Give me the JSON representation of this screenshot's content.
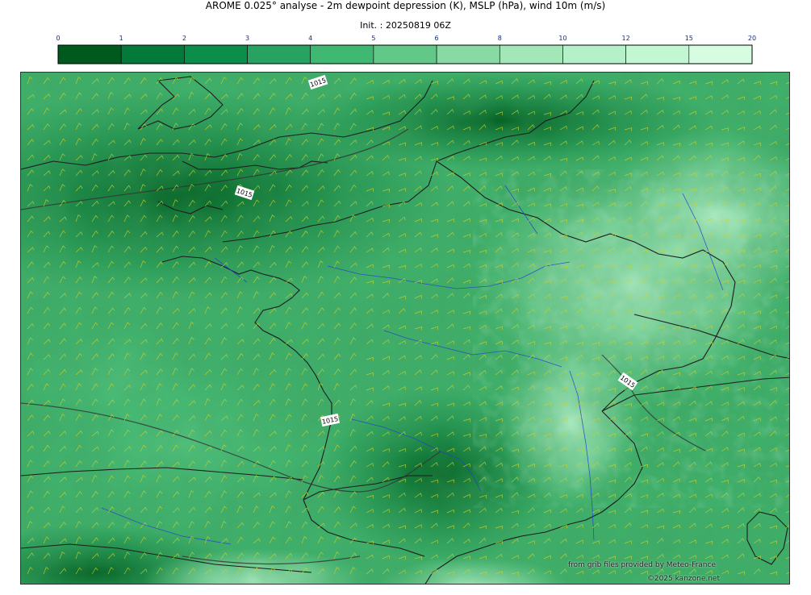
{
  "header": {
    "title": "AROME 0.025° analyse - 2m dewpoint depression (K), MSLP (hPa), wind 10m (m/s)",
    "init": "Init. : 20250819 06Z"
  },
  "colorbar": {
    "ticks": [
      "0",
      "1",
      "2",
      "3",
      "4",
      "5",
      "6",
      "8",
      "10",
      "12",
      "15",
      "20"
    ],
    "colors": [
      "#005a1e",
      "#037a3a",
      "#0a8e4a",
      "#28a260",
      "#3fb872",
      "#62c887",
      "#88d9a4",
      "#a3e6b8",
      "#b4f0c8",
      "#c3f7d4",
      "#d6fde2"
    ],
    "tick_color": "#1a2a80"
  },
  "map": {
    "land_bg": "#3faf6a",
    "coast_color": "#1c1c1c",
    "river_color": "#2540d0",
    "barb_color": "#c9d32a",
    "isobar_labels": [
      "1015",
      "1015",
      "1015",
      "1015"
    ]
  },
  "credits": {
    "line1": "from grib files provided by Meteo-France",
    "line2": "©2025 kanzone.net"
  }
}
